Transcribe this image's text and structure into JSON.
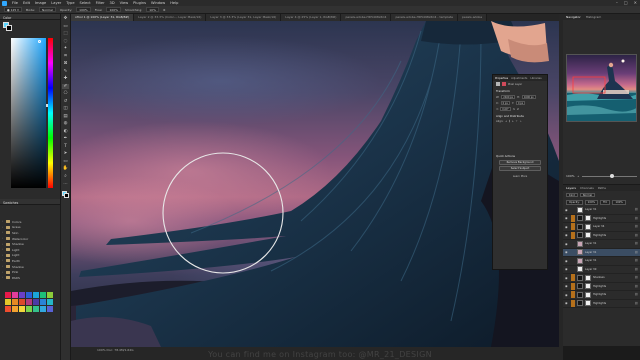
{
  "app": {
    "name": "Adobe Photoshop"
  },
  "menubar": {
    "items": [
      "File",
      "Edit",
      "Image",
      "Layer",
      "Type",
      "Select",
      "Filter",
      "3D",
      "View",
      "Plugins",
      "Window",
      "Help"
    ]
  },
  "options": {
    "mode_label": "Mode:",
    "mode_value": "Normal",
    "opacity_label": "Opacity:",
    "opacity_value": "100%",
    "flow_label": "Flow:",
    "flow_value": "100%",
    "smoothing_label": "Smoothing:",
    "smoothing_value": "10%"
  },
  "tabs": [
    {
      "label": "oTool 1 @ 100% (Layer 31, RGB/8#)",
      "active": true
    },
    {
      "label": "Layer 2 @ 33.3% (Color..., Layer Mask/16)",
      "active": false
    },
    {
      "label": "Layer 3 @ 33.3% (Layer 31, Layer Mask/16)",
      "active": false
    },
    {
      "label": "Layer 4 @ 25% (Layer 1, RGB/8#)",
      "active": false
    },
    {
      "label": "pexels-adobe-HD5498x6C4",
      "active": false
    },
    {
      "label": "pexels-adobe-HD5498x6C4 - template",
      "active": false
    },
    {
      "label": "pexels-adobe",
      "active": false
    }
  ],
  "left_panel": {
    "color_title": "Color",
    "swatches_title": "Swatches",
    "folders": [
      "Colors",
      "Grass",
      "Skin",
      "Watercolor",
      "Shadow",
      "Light",
      "Light",
      "Earth",
      "Shadow",
      "Pink",
      "PADS"
    ],
    "swatch_colors": [
      "#e8194a",
      "#e23d9b",
      "#6b3fc8",
      "#2b5fd6",
      "#1aa6d8",
      "#1dbf7a",
      "#8ccd3a",
      "#e4c82a",
      "#e58a24",
      "#db4b2b",
      "#b23b7d",
      "#4b3aa7",
      "#2a83d8",
      "#25b6c7",
      "#f04d2f",
      "#f2a230",
      "#f2d83c",
      "#79d44c",
      "#34c18d",
      "#32a8df",
      "#5862d6"
    ]
  },
  "toolbar": {
    "tools": [
      "move-tool",
      "artboard-tool",
      "marquee-tool",
      "lasso-tool",
      "quick-select-tool",
      "crop-tool",
      "frame-tool",
      "eyedropper-tool",
      "healing-tool",
      "brush-tool",
      "stamp-tool",
      "history-brush-tool",
      "eraser-tool",
      "gradient-tool",
      "blur-tool",
      "dodge-tool",
      "pen-tool",
      "type-tool",
      "path-select-tool",
      "rectangle-tool",
      "hand-tool",
      "zoom-tool",
      "more-tools-icon"
    ],
    "glyphs": [
      "✥",
      "▭",
      "⬚",
      "◌",
      "✦",
      "⌗",
      "⊠",
      "✎",
      "✚",
      "✐",
      "⎔",
      "↺",
      "◫",
      "▤",
      "◍",
      "◐",
      "✒",
      "T",
      "➤",
      "▭",
      "✋",
      "⌕",
      "…"
    ],
    "active_index": 9
  },
  "properties": {
    "tabs": [
      "Properties",
      "Adjustments",
      "Libraries"
    ],
    "pixel_layer_label": "Pixel Layer",
    "transform_title": "Transform",
    "w_label": "W:",
    "h_label": "H:",
    "x_label": "X:",
    "y_label": "Y:",
    "w_value": "2400 px",
    "h_value": "1600 px",
    "x_value": "0 px",
    "y_value": "0 px",
    "angle_value": "0.00°",
    "align_title": "Align and Distribute",
    "align_label": "Align:",
    "quick_actions_title": "Quick Actions",
    "remove_bg_label": "Remove Background",
    "select_subject_label": "Select Subject",
    "learn_more_label": "Learn More"
  },
  "navigator": {
    "tabs": [
      "Navigator",
      "Histogram"
    ],
    "zoom_value": "100%",
    "zoom_level": 0.55
  },
  "layers": {
    "tabs": [
      "Layers",
      "Channels",
      "Paths"
    ],
    "kind_label": "Kind",
    "blend_mode": "Normal",
    "opacity_label": "Opacity:",
    "opacity_value": "100%",
    "fill_label": "Fill:",
    "fill_value": "100%",
    "rows": [
      {
        "name": "Layer 31",
        "orange": false,
        "thumb": "w",
        "mask": false,
        "selected": false
      },
      {
        "name": "Highlights",
        "orange": true,
        "thumb": "k",
        "mask": true,
        "selected": false
      },
      {
        "name": "Layer 34",
        "orange": true,
        "thumb": "k",
        "mask": true,
        "selected": false
      },
      {
        "name": "Highlights",
        "orange": true,
        "thumb": "k",
        "mask": true,
        "selected": false
      },
      {
        "name": "Layer 31",
        "orange": false,
        "thumb": "p",
        "mask": false,
        "selected": false
      },
      {
        "name": "Layer 31",
        "orange": false,
        "thumb": "p",
        "mask": false,
        "selected": true
      },
      {
        "name": "Layer 31",
        "orange": false,
        "thumb": "p",
        "mask": false,
        "selected": false
      },
      {
        "name": "Layer 30",
        "orange": false,
        "thumb": "w",
        "mask": false,
        "selected": false
      },
      {
        "name": "Shadows",
        "orange": true,
        "thumb": "k",
        "mask": true,
        "selected": false
      },
      {
        "name": "Highlights",
        "orange": true,
        "thumb": "k",
        "mask": true,
        "selected": false
      },
      {
        "name": "Highlights",
        "orange": true,
        "thumb": "k",
        "mask": true,
        "selected": false
      },
      {
        "name": "Highlights",
        "orange": true,
        "thumb": "k",
        "mask": true,
        "selected": false
      }
    ]
  },
  "status": {
    "zoom_text": "100%  Doc: 78.4M/1.62G"
  },
  "watermark": "You can find me on Instagram too: @MR_21_DESIGN",
  "colors": {
    "accent": "#31a8ff",
    "foreground": "#5cd7ff",
    "background": "#000000",
    "layer_group": "#b5701b",
    "selection": "#3b4d63"
  }
}
